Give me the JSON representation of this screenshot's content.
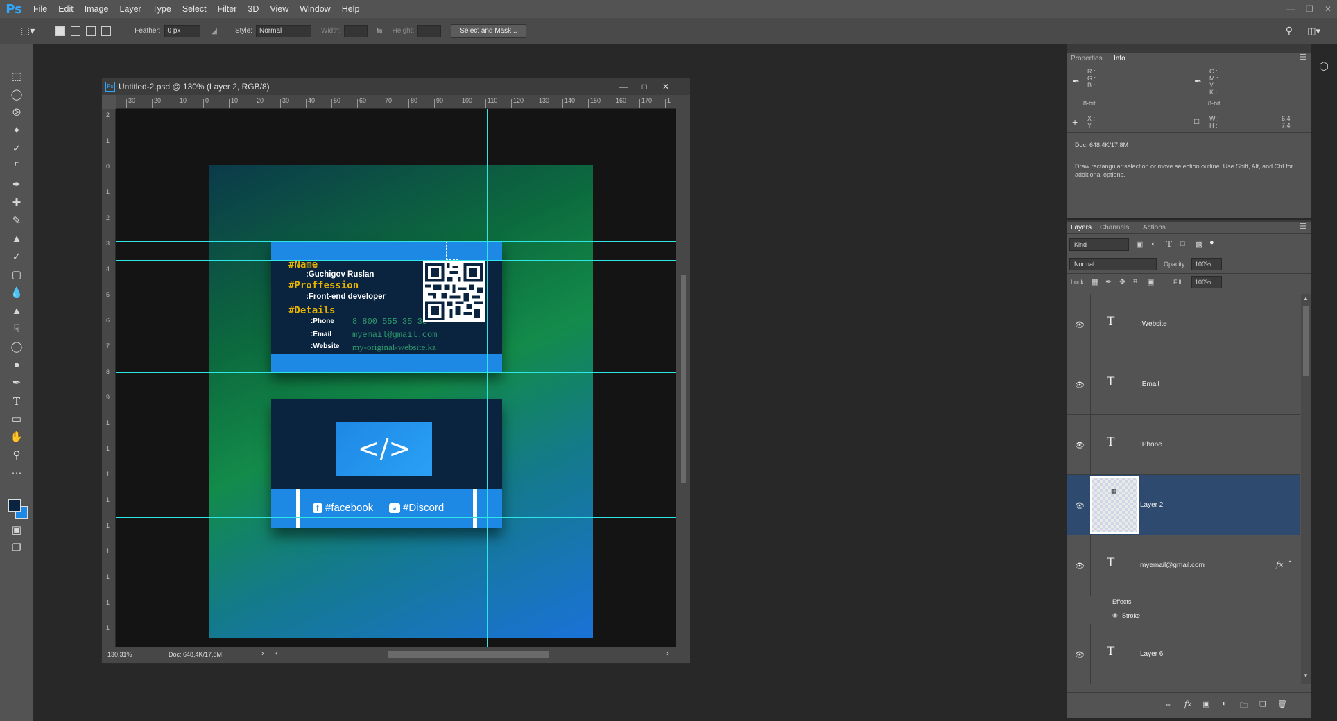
{
  "menu": {
    "logo": "Ps",
    "items": [
      "File",
      "Edit",
      "Image",
      "Layer",
      "Type",
      "Select",
      "Filter",
      "3D",
      "View",
      "Window",
      "Help"
    ]
  },
  "options": {
    "feather_label": "Feather:",
    "feather_value": "0 px",
    "style_label": "Style:",
    "style_value": "Normal",
    "width_label": "Width:",
    "height_label": "Height:",
    "select_mask": "Select and Mask..."
  },
  "document": {
    "title": "Untitled-2.psd @ 130% (Layer 2, RGB/8)",
    "zoom": "130,31%",
    "doc_info": "Doc: 648,4K/17,8M",
    "hruler": [
      "30",
      "20",
      "10",
      "0",
      "10",
      "20",
      "30",
      "40",
      "50",
      "60",
      "70",
      "80",
      "90",
      "100",
      "110",
      "120",
      "130",
      "140",
      "150",
      "160",
      "170",
      "1"
    ],
    "vruler": [
      "2",
      "1",
      "0",
      "1",
      "2",
      "3",
      "4",
      "5",
      "6",
      "7",
      "8",
      "9",
      "1",
      "1",
      "1",
      "1",
      "1",
      "1",
      "1",
      "1",
      "1"
    ]
  },
  "card_front": {
    "name_tag": "#Name",
    "name": ":Guchigov Ruslan",
    "prof_tag": "#Proffession",
    "prof": ":Front-end developer",
    "details_tag": "#Details",
    "phone_label": ":Phone",
    "phone": "8 800 555 35 35",
    "email_label": ":Email",
    "email": "myemail@gmail.com",
    "website_label": ":Website",
    "website": "my-original-website.kz"
  },
  "card_back": {
    "code_symbol": "</>",
    "facebook": "#facebook",
    "discord": "#Discord"
  },
  "info_panel": {
    "tab_properties": "Properties",
    "tab_info": "Info",
    "rgb": "R :\nG :\nB :",
    "cmyk": "C :\nM :\nY :\nK :",
    "bits1": "8-bit",
    "bits2": "8-bit",
    "xy": "X :\nY :",
    "wh": "W :\nH :",
    "w_val": "6,4",
    "h_val": "7,4",
    "doc": "Doc: 648,4K/17,8M",
    "hint": "Draw rectangular selection or move selection outline.  Use Shift, Alt, and Ctrl for additional options."
  },
  "layers_panel": {
    "tab_layers": "Layers",
    "tab_channels": "Channels",
    "tab_actions": "Actions",
    "kind": "Kind",
    "blend": "Normal",
    "opacity_label": "Opacity:",
    "opacity": "100%",
    "lock_label": "Lock:",
    "fill_label": "Fill:",
    "fill": "100%",
    "layers": [
      {
        "name": ":Website",
        "type": "text"
      },
      {
        "name": ":Email",
        "type": "text"
      },
      {
        "name": ":Phone",
        "type": "text"
      },
      {
        "name": "Layer 2",
        "type": "image",
        "selected": true
      },
      {
        "name": "myemail@gmail.com",
        "type": "text",
        "fx": "fx"
      },
      {
        "name": "Layer 6",
        "type": "text"
      }
    ],
    "effects_label": "Effects",
    "stroke_label": "Stroke"
  },
  "colors": {
    "accent": "#1e88e5",
    "guide": "#2fe6e6",
    "fg_swatch": "#0a2440",
    "bg_swatch": "#1e88e5"
  }
}
